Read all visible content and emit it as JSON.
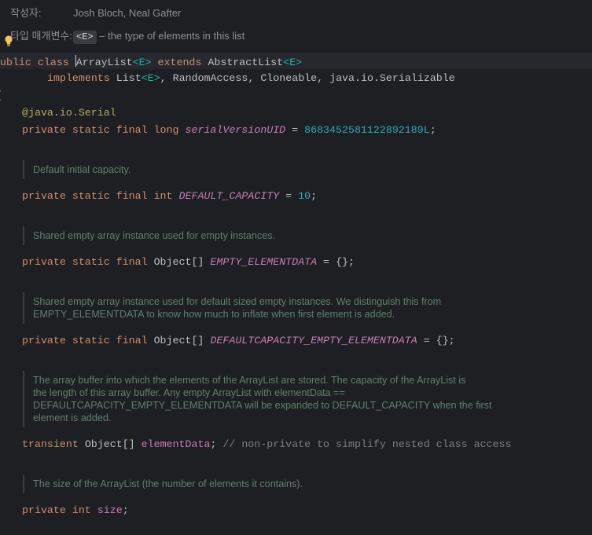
{
  "javadoc_header": {
    "author_label": "작성자:",
    "author_value": "Josh Bloch, Neal Gafter",
    "type_param_label": "타입 매개변수:",
    "type_param_name": "<E>",
    "type_param_desc": "– the type of elements in this list"
  },
  "code": {
    "class_decl": {
      "kw_public": "public",
      "kw_class": "class",
      "class_name": "ArrayList",
      "type_param": "<E>",
      "kw_extends": "extends",
      "super_class": "AbstractList",
      "super_type_param": "<E>"
    },
    "implements_line": {
      "kw_implements": "implements",
      "iface_list": "List",
      "iface_list_param": "<E>",
      "rest": ", RandomAccess, Cloneable, java.io.Serializable"
    },
    "open_brace": "{",
    "annotation_at": "@",
    "annotation_name": "java.io.Serial",
    "serial_field": {
      "modifiers": "private static final",
      "type": "long",
      "name": "serialVersionUID",
      "assign": " = ",
      "value": "8683452581122892189L",
      "end": ";"
    },
    "default_capacity": {
      "doc": "Default initial capacity.",
      "modifiers": "private static final",
      "type": "int",
      "name": "DEFAULT_CAPACITY",
      "assign": " = ",
      "value": "10",
      "end": ";"
    },
    "empty_elementdata": {
      "doc": "Shared empty array instance used for empty instances.",
      "modifiers": "private static final",
      "type": "Object[]",
      "name": "EMPTY_ELEMENTDATA",
      "rest": " = {};"
    },
    "defaultcapacity_empty": {
      "doc_line1": "Shared empty array instance used for default sized empty instances. We distinguish this from",
      "doc_line2": "EMPTY_ELEMENTDATA to know how much to inflate when first element is added.",
      "modifiers": "private static final",
      "type": "Object[]",
      "name": "DEFAULTCAPACITY_EMPTY_ELEMENTDATA",
      "rest": " = {};"
    },
    "element_data": {
      "doc_line1": "The array buffer into which the elements of the ArrayList are stored. The capacity of the ArrayList is",
      "doc_line2": "the length of this array buffer. Any empty ArrayList with elementData ==",
      "doc_line3": "DEFAULTCAPACITY_EMPTY_ELEMENTDATA will be expanded to DEFAULT_CAPACITY when the first",
      "doc_line4": "element is added.",
      "modifier": "transient",
      "type": "Object[]",
      "name": "elementData",
      "end": ";",
      "comment": "// non-private to simplify nested class access"
    },
    "size_field": {
      "doc": "The size of the ArrayList (the number of elements it contains).",
      "modifier": "private",
      "type": "int",
      "name": "size",
      "end": ";"
    }
  },
  "icons": {
    "intention": "lightbulb-icon"
  },
  "colors": {
    "background": "#1e1f22",
    "keyword": "#cf8e6d",
    "type_param": "#16baac",
    "field": "#c77dbb",
    "number": "#2aacb8",
    "annotation": "#b3ae60",
    "doc_text": "#5f826b",
    "comment": "#7a7e85"
  }
}
